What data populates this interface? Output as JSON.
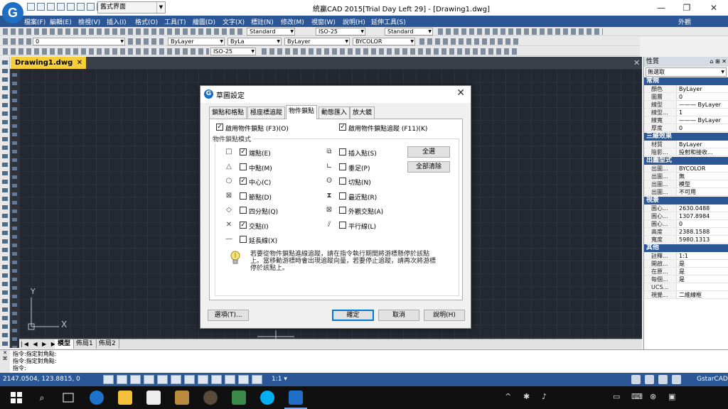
{
  "app": {
    "logo_letter": "G",
    "workspace": "舊式界面",
    "title": "統贏CAD 2015[Trial Day Left 29] - [Drawing1.dwg]",
    "brand_color": "#2b5797"
  },
  "window_controls": {
    "minimize": "—",
    "restore": "❐",
    "close": "✕"
  },
  "menu": {
    "items": [
      "檔案(F)",
      "編輯(E)",
      "檢視(V)",
      "插入(I)",
      "格式(O)",
      "工具(T)",
      "繪圖(D)",
      "文字(X)",
      "標註(N)",
      "修改(M)",
      "視窗(W)",
      "說明(H)",
      "延伸工具(S)"
    ],
    "right": "外觀"
  },
  "toolbar": {
    "text_style": "Standard",
    "dim_style": "ISO-25",
    "table_style": "Standard",
    "layer": "0",
    "color": "ByLayer",
    "linetype": "ByLa",
    "lineweight": "ByLayer",
    "plotstyle": "BYCOLOR",
    "dim_style2": "ISO-25"
  },
  "document": {
    "tab_label": "Drawing1.dwg",
    "close": "✕"
  },
  "canvas": {
    "axis_y": "Y",
    "axis_x": "X"
  },
  "layouts": {
    "nav": "|◀ ◀ ▶ ▶|",
    "tabs": [
      "模型",
      "佈局1",
      "佈局2"
    ]
  },
  "properties": {
    "title": "性質",
    "selection": "無選取",
    "sections": [
      {
        "name": "常規",
        "rows": [
          {
            "k": "顏色",
            "v": "ByLayer"
          },
          {
            "k": "圖層",
            "v": "0"
          },
          {
            "k": "線型",
            "v": "——— ByLayer"
          },
          {
            "k": "線型...",
            "v": "1"
          },
          {
            "k": "線寬",
            "v": "——— ByLayer"
          },
          {
            "k": "厚度",
            "v": "0"
          }
        ]
      },
      {
        "name": "三維效果",
        "rows": [
          {
            "k": "材質",
            "v": "ByLayer"
          },
          {
            "k": "陰影...",
            "v": "投射和接收..."
          }
        ]
      },
      {
        "name": "出圖型式",
        "rows": [
          {
            "k": "出圖...",
            "v": "BYCOLOR"
          },
          {
            "k": "出圖...",
            "v": "無"
          },
          {
            "k": "出圖...",
            "v": "模型"
          },
          {
            "k": "出圖...",
            "v": "不可用"
          }
        ]
      },
      {
        "name": "視景",
        "rows": [
          {
            "k": "圓心...",
            "v": "2630.0488"
          },
          {
            "k": "圓心...",
            "v": "1307.8984"
          },
          {
            "k": "圓心...",
            "v": "0"
          },
          {
            "k": "高度",
            "v": "2388.1588"
          },
          {
            "k": "寬度",
            "v": "5980.1313"
          }
        ]
      },
      {
        "name": "其他",
        "rows": [
          {
            "k": "註釋...",
            "v": "1:1"
          },
          {
            "k": "開啟...",
            "v": "是"
          },
          {
            "k": "在原...",
            "v": "是"
          },
          {
            "k": "每個...",
            "v": "是"
          },
          {
            "k": "UCS...",
            "v": ""
          },
          {
            "k": "視覺...",
            "v": "二維線框"
          }
        ]
      }
    ]
  },
  "command": {
    "lines": [
      "指令:指定對角點:",
      "指令:指定對角點:",
      "指令:"
    ]
  },
  "status": {
    "coords": "2147.0504, 123.8815, 0",
    "scale": "1:1 ▾",
    "brand": "GstarCAD"
  },
  "taskbar": {
    "search_icon": "⌕",
    "tray": [
      "^",
      "✱",
      "♪",
      "▭",
      "⌨",
      "⊗",
      "▣"
    ]
  },
  "dialog": {
    "title": "草圖設定",
    "tabs": [
      "鎖點和格點",
      "極座標追蹤",
      "物件鎖點",
      "動態匯入",
      "放大鏡"
    ],
    "active_tab": "物件鎖點",
    "enable_osnap": "啟用物件鎖點 (F3)(O)",
    "enable_osnap_checked": true,
    "enable_tracking": "啟用物件鎖點追蹤 (F11)(K)",
    "enable_tracking_checked": true,
    "group_label": "物件鎖點模式",
    "modes_left": [
      {
        "symbol": "□",
        "label": "端點(E)",
        "checked": true
      },
      {
        "symbol": "△",
        "label": "中點(M)",
        "checked": false
      },
      {
        "symbol": "○",
        "label": "中心(C)",
        "checked": true
      },
      {
        "symbol": "⊠",
        "label": "節點(D)",
        "checked": false
      },
      {
        "symbol": "◇",
        "label": "四分點(Q)",
        "checked": false
      },
      {
        "symbol": "✕",
        "label": "交點(I)",
        "checked": true
      },
      {
        "symbol": "—",
        "label": "延長線(X)",
        "checked": false
      }
    ],
    "modes_right": [
      {
        "symbol": "⧉",
        "label": "插入點(S)",
        "checked": false
      },
      {
        "symbol": "∟",
        "label": "垂足(P)",
        "checked": false
      },
      {
        "symbol": "ʘ",
        "label": "切點(N)",
        "checked": false
      },
      {
        "symbol": "⧗",
        "label": "最近點(R)",
        "checked": false
      },
      {
        "symbol": "⊠",
        "label": "外觀交點(A)",
        "checked": false
      },
      {
        "symbol": "⫽",
        "label": "平行線(L)",
        "checked": false
      }
    ],
    "select_all": "全選",
    "clear_all": "全部清除",
    "hint": "若要從物件鎖點進線追蹤，請在指令執行期間將游標懸停於該點上。當移動游標時會出現追蹤向量，若要停止追蹤，請再次將游標停於該點上。",
    "options_button": "選項(T)...",
    "ok_button": "確定",
    "cancel_button": "取消",
    "help_button": "說明(H)"
  }
}
